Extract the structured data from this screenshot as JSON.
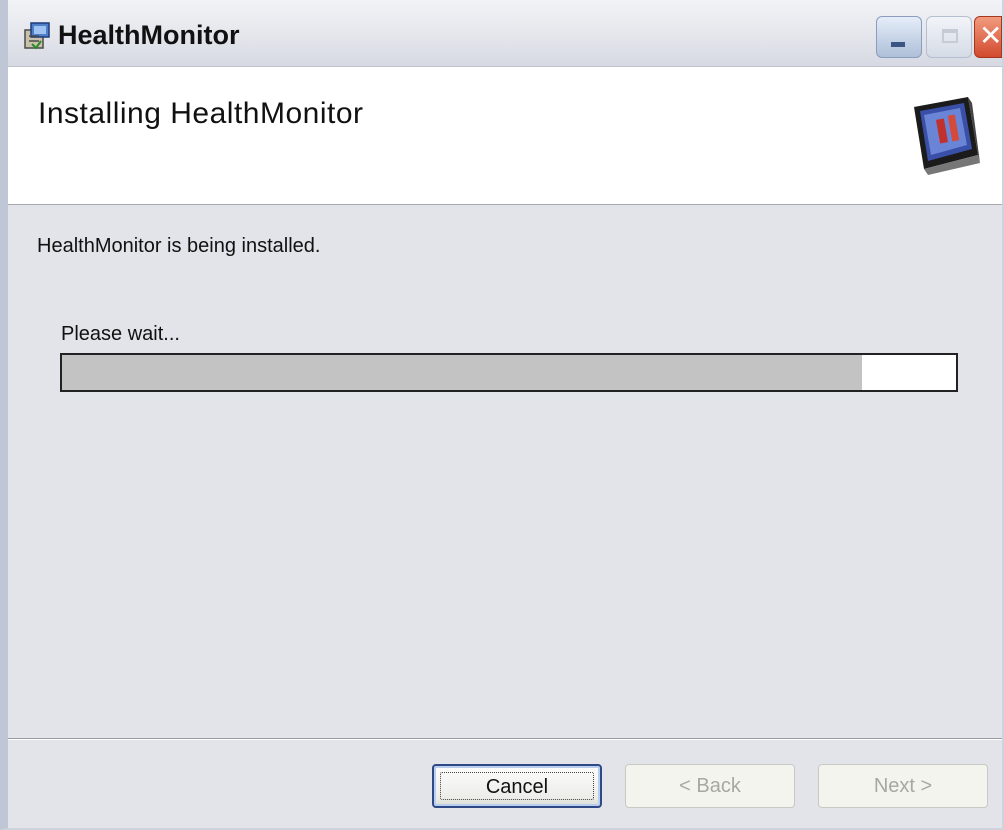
{
  "window": {
    "title": "HealthMonitor",
    "icon": "installer-package-icon",
    "controls": [
      "minimize-icon",
      "maximize-icon",
      "close-icon"
    ],
    "close_glyph": "✕"
  },
  "header": {
    "title": "Installing HealthMonitor",
    "graphic": "installer-monitor-graphic"
  },
  "content": {
    "status": "HealthMonitor is being installed.",
    "wait_label": "Please wait...",
    "progress_fraction": 0.895
  },
  "buttons": {
    "cancel": "Cancel",
    "back": "< Back",
    "next": "Next >"
  },
  "colors": {
    "window_bg": "#e3e3ea",
    "progress_fill": "#c3c3c3",
    "close_button": "#d24a2e",
    "default_button_border": "#2d4a86"
  }
}
